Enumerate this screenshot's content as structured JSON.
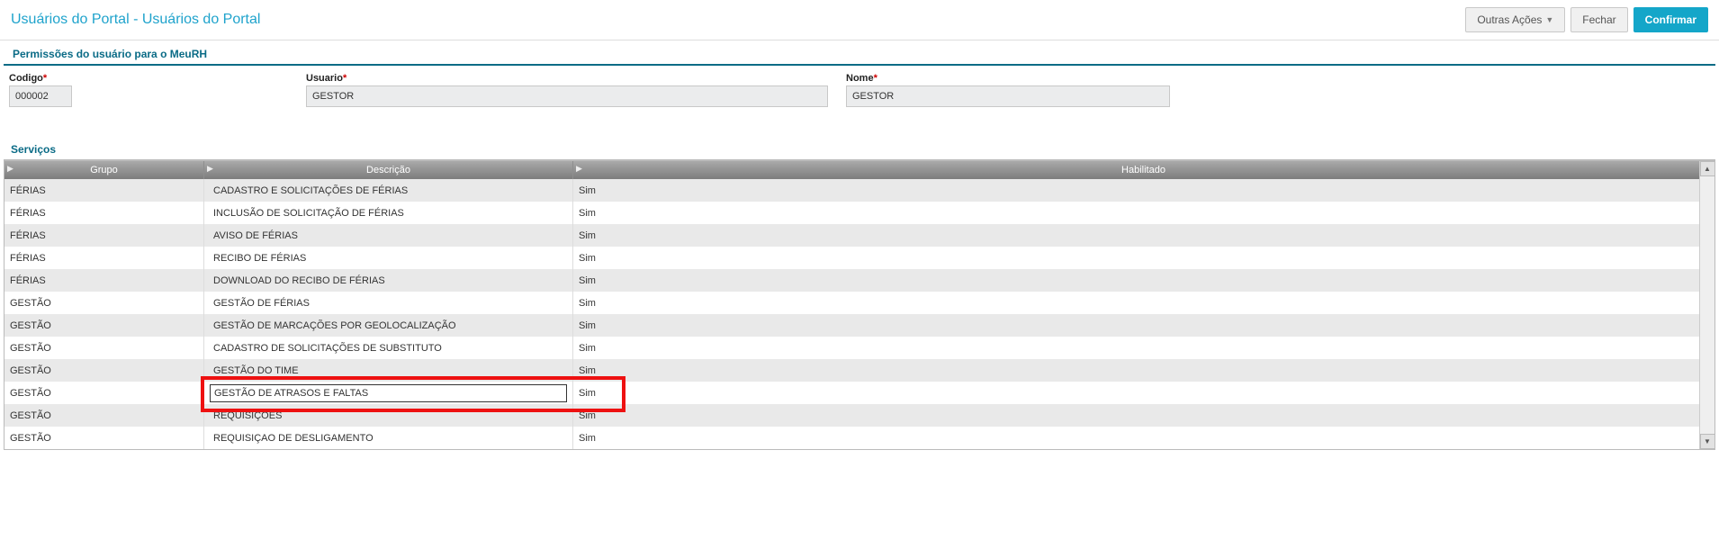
{
  "topbar": {
    "breadcrumb": "Usuários do Portal - Usuários do Portal",
    "other_actions": "Outras Ações",
    "close": "Fechar",
    "confirm": "Confirmar"
  },
  "section_permissions_title": "Permissões do usuário para o MeuRH",
  "form": {
    "codigo_label": "Codigo",
    "codigo_value": "000002",
    "usuario_label": "Usuario",
    "usuario_value": "GESTOR",
    "nome_label": "Nome",
    "nome_value": "GESTOR"
  },
  "section_services_title": "Serviços",
  "grid": {
    "headers": {
      "grupo": "Grupo",
      "descricao": "Descrição",
      "habilitado": "Habilitado"
    },
    "rows": [
      {
        "grupo": "FÉRIAS",
        "descricao": "CADASTRO E SOLICITAÇÕES DE FÉRIAS",
        "habilitado": "Sim"
      },
      {
        "grupo": "FÉRIAS",
        "descricao": "INCLUSÃO DE SOLICITAÇÃO DE FÉRIAS",
        "habilitado": "Sim"
      },
      {
        "grupo": "FÉRIAS",
        "descricao": "AVISO DE FÉRIAS",
        "habilitado": "Sim"
      },
      {
        "grupo": "FÉRIAS",
        "descricao": "RECIBO DE FÉRIAS",
        "habilitado": "Sim"
      },
      {
        "grupo": "FÉRIAS",
        "descricao": "DOWNLOAD DO RECIBO DE FÉRIAS",
        "habilitado": "Sim"
      },
      {
        "grupo": "GESTÃO",
        "descricao": "GESTÃO DE FÉRIAS",
        "habilitado": "Sim"
      },
      {
        "grupo": "GESTÃO",
        "descricao": "GESTÃO DE MARCAÇÕES POR GEOLOCALIZAÇÃO",
        "habilitado": "Sim"
      },
      {
        "grupo": "GESTÃO",
        "descricao": "CADASTRO DE SOLICITAÇÕES DE SUBSTITUTO",
        "habilitado": "Sim"
      },
      {
        "grupo": "GESTÃO",
        "descricao": "GESTÃO DO TIME",
        "habilitado": "Sim"
      },
      {
        "grupo": "GESTÃO",
        "descricao": "GESTÃO DE ATRASOS E FALTAS",
        "habilitado": "Sim"
      },
      {
        "grupo": "GESTÃO",
        "descricao": "REQUISIÇÕES",
        "habilitado": "Sim"
      },
      {
        "grupo": "GESTÃO",
        "descricao": "REQUISIÇAO DE DESLIGAMENTO",
        "habilitado": "Sim"
      }
    ],
    "selected_row_index": 9
  }
}
